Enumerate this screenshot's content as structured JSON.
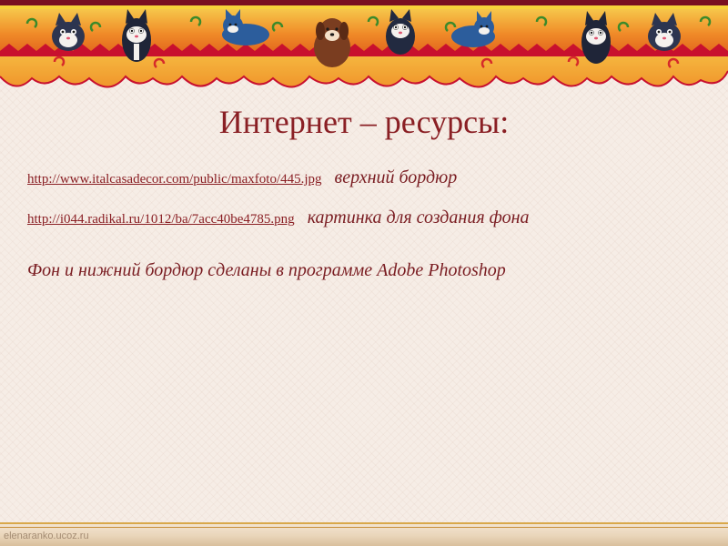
{
  "slide": {
    "title": "Интернет – ресурсы:",
    "resources": [
      {
        "url": "http://www.italcasadecor.com/public/maxfoto/445.jpg",
        "caption": "верхний бордюр"
      },
      {
        "url": "http://i044.radikal.ru/1012/ba/7acc40be4785.png",
        "caption": "картинка для создания фона"
      }
    ],
    "note": "Фон  и нижний бордюр сделаны в программе Adobe Photoshop",
    "watermark": "elenaranko.ucoz.ru"
  },
  "colors": {
    "title": "#8a1f24",
    "text": "#7a1d22",
    "background": "#f6ede6",
    "border_orange": "#f0a030",
    "border_red": "#c8102e",
    "border_gold": "#f7d23a"
  },
  "icons": [
    "cat-icon",
    "dog-icon",
    "swirl-icon"
  ]
}
